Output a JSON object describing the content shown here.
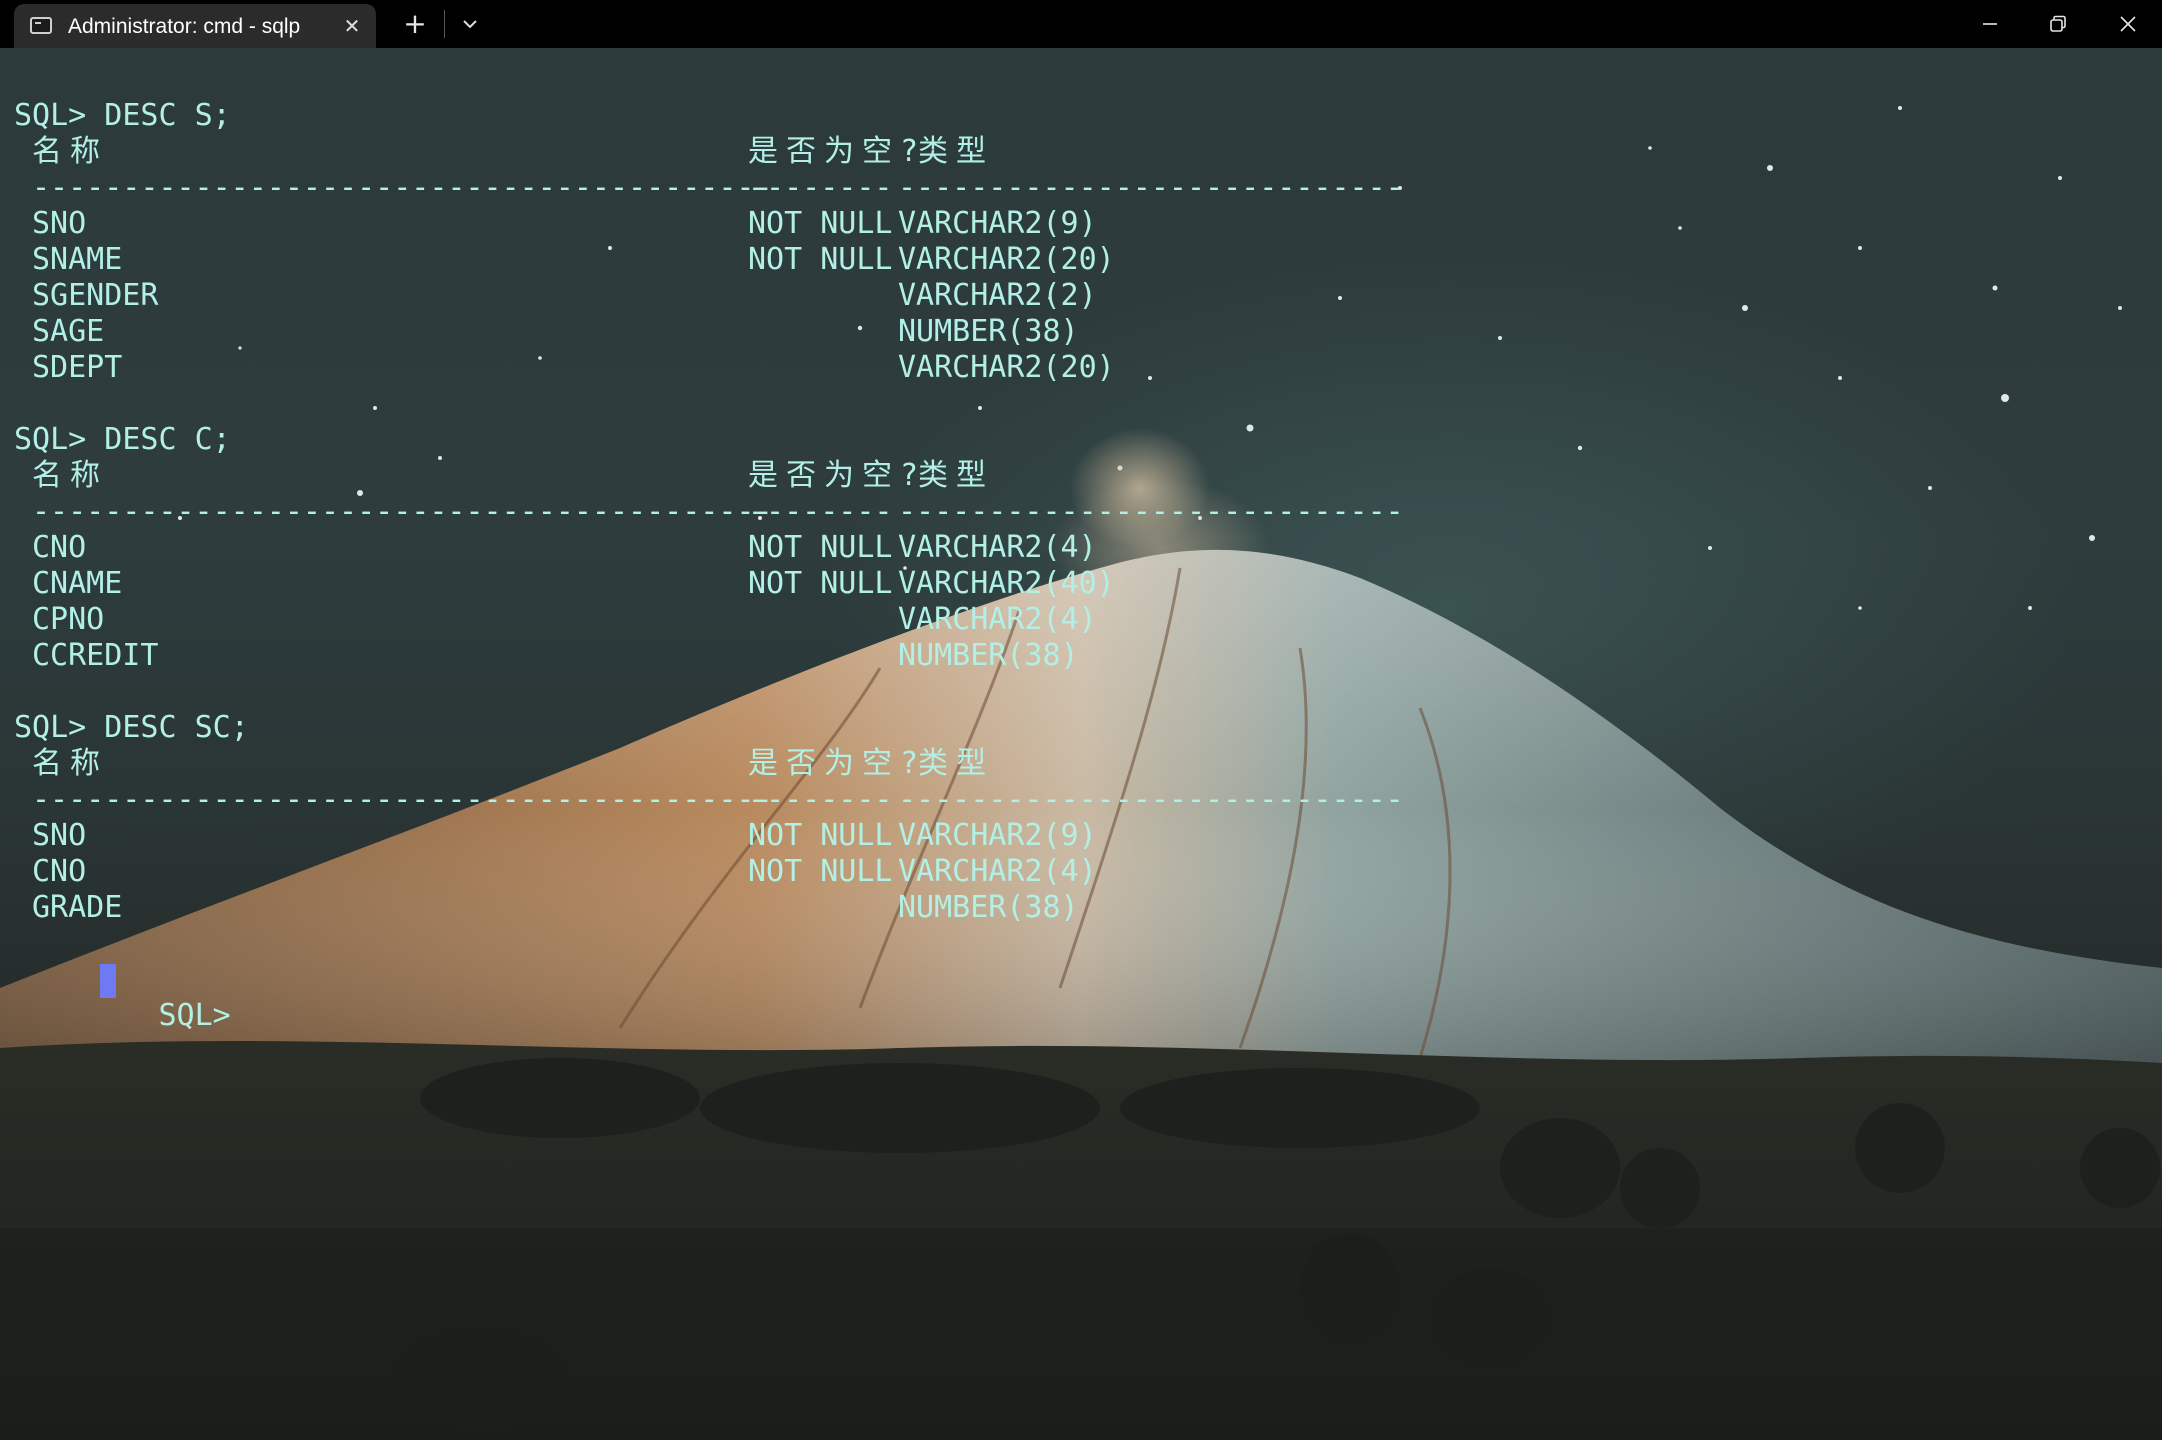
{
  "window": {
    "tab_title": "Administrator: cmd - sqlp",
    "tab_icon": "terminal-icon",
    "new_tab_symbol": "+",
    "close_tab_symbol": "✕",
    "dropdown_icon": "chevron-down-icon",
    "controls": [
      "minimize-icon",
      "restore-icon",
      "close-icon"
    ]
  },
  "terminal": {
    "colors": {
      "foreground": "#b2f0e6",
      "cursor": "#6f79f2",
      "titlebar": "#000000",
      "tab": "#2b2b2b"
    },
    "separator": {
      "name": "-----------------------------------------",
      "null": "--------",
      "type": "----------------------------"
    },
    "header": {
      "name": "名称",
      "null": "是否为空?",
      "type": "类型"
    },
    "blocks": [
      {
        "command": "SQL> DESC S;",
        "rows": [
          {
            "name": "SNO",
            "null": "NOT NULL",
            "type": "VARCHAR2(9)"
          },
          {
            "name": "SNAME",
            "null": "NOT NULL",
            "type": "VARCHAR2(20)"
          },
          {
            "name": "SGENDER",
            "null": "",
            "type": "VARCHAR2(2)"
          },
          {
            "name": "SAGE",
            "null": "",
            "type": "NUMBER(38)"
          },
          {
            "name": "SDEPT",
            "null": "",
            "type": "VARCHAR2(20)"
          }
        ]
      },
      {
        "command": "SQL> DESC C;",
        "rows": [
          {
            "name": "CNO",
            "null": "NOT NULL",
            "type": "VARCHAR2(4)"
          },
          {
            "name": "CNAME",
            "null": "NOT NULL",
            "type": "VARCHAR2(40)"
          },
          {
            "name": "CPNO",
            "null": "",
            "type": "VARCHAR2(4)"
          },
          {
            "name": "CCREDIT",
            "null": "",
            "type": "NUMBER(38)"
          }
        ]
      },
      {
        "command": "SQL> DESC SC;",
        "rows": [
          {
            "name": "SNO",
            "null": "NOT NULL",
            "type": "VARCHAR2(9)"
          },
          {
            "name": "CNO",
            "null": "NOT NULL",
            "type": "VARCHAR2(4)"
          },
          {
            "name": "GRADE",
            "null": "",
            "type": "NUMBER(38)"
          }
        ]
      }
    ],
    "prompt": "SQL>"
  }
}
